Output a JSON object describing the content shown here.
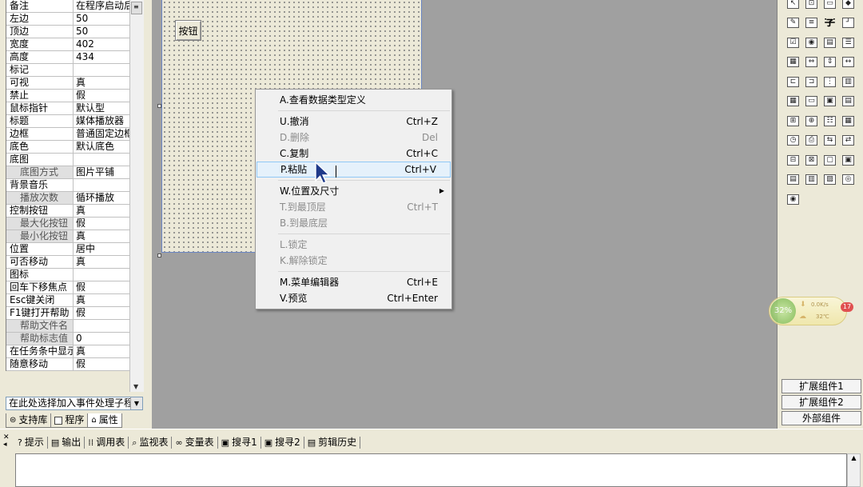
{
  "properties": [
    {
      "name": "备注",
      "value": "在程序启动后",
      "sub": false
    },
    {
      "name": "左边",
      "value": "50",
      "sub": false
    },
    {
      "name": "顶边",
      "value": "50",
      "sub": false
    },
    {
      "name": "宽度",
      "value": "402",
      "sub": false
    },
    {
      "name": "高度",
      "value": "434",
      "sub": false
    },
    {
      "name": "标记",
      "value": "",
      "sub": false
    },
    {
      "name": "可视",
      "value": "真",
      "sub": false
    },
    {
      "name": "禁止",
      "value": "假",
      "sub": false
    },
    {
      "name": "鼠标指针",
      "value": "默认型",
      "sub": false
    },
    {
      "name": "标题",
      "value": "媒体播放器",
      "sub": false
    },
    {
      "name": "边框",
      "value": "普通固定边框",
      "sub": false
    },
    {
      "name": "底色",
      "value": "默认底色",
      "sub": false
    },
    {
      "name": "底图",
      "value": "",
      "sub": false
    },
    {
      "name": "底图方式",
      "value": "图片平铺",
      "sub": true
    },
    {
      "name": "背景音乐",
      "value": "",
      "sub": false
    },
    {
      "name": "播放次数",
      "value": "循环播放",
      "sub": true
    },
    {
      "name": "控制按钮",
      "value": "真",
      "sub": false
    },
    {
      "name": "最大化按钮",
      "value": "假",
      "sub": true
    },
    {
      "name": "最小化按钮",
      "value": "真",
      "sub": true
    },
    {
      "name": "位置",
      "value": "居中",
      "sub": false
    },
    {
      "name": "可否移动",
      "value": "真",
      "sub": false
    },
    {
      "name": "图标",
      "value": "",
      "sub": false
    },
    {
      "name": "回车下移焦点",
      "value": "假",
      "sub": false
    },
    {
      "name": "Esc键关闭",
      "value": "真",
      "sub": false
    },
    {
      "name": "F1键打开帮助",
      "value": "假",
      "sub": false
    },
    {
      "name": "帮助文件名",
      "value": "",
      "sub": true
    },
    {
      "name": "帮助标志值",
      "value": "0",
      "sub": true
    },
    {
      "name": "在任务条中显示",
      "value": "真",
      "sub": false
    },
    {
      "name": "随意移动",
      "value": "假",
      "sub": false
    }
  ],
  "event_select": "在此处选择加入事件处理子程序",
  "panel_tabs": [
    "支持库",
    "程序",
    "属性"
  ],
  "form_button_label": "按钮",
  "context_menu": [
    {
      "type": "item",
      "label": "A.查看数据类型定义",
      "shortcut": "",
      "disabled": false,
      "hover": false,
      "submenu": false
    },
    {
      "type": "sep"
    },
    {
      "type": "item",
      "label": "U.撤消",
      "shortcut": "Ctrl+Z",
      "disabled": false,
      "hover": false,
      "submenu": false
    },
    {
      "type": "item",
      "label": "D.删除",
      "shortcut": "Del",
      "disabled": true,
      "hover": false,
      "submenu": false
    },
    {
      "type": "item",
      "label": "C.复制",
      "shortcut": "Ctrl+C",
      "disabled": false,
      "hover": false,
      "submenu": false
    },
    {
      "type": "item",
      "label": "P.粘贴",
      "shortcut": "Ctrl+V",
      "disabled": false,
      "hover": true,
      "submenu": false
    },
    {
      "type": "sep"
    },
    {
      "type": "item",
      "label": "W.位置及尺寸",
      "shortcut": "",
      "disabled": false,
      "hover": false,
      "submenu": true
    },
    {
      "type": "item",
      "label": "T.到最顶层",
      "shortcut": "Ctrl+T",
      "disabled": true,
      "hover": false,
      "submenu": false
    },
    {
      "type": "item",
      "label": "B.到最底层",
      "shortcut": "",
      "disabled": true,
      "hover": false,
      "submenu": false
    },
    {
      "type": "sep"
    },
    {
      "type": "item",
      "label": "L.锁定",
      "shortcut": "",
      "disabled": true,
      "hover": false,
      "submenu": false
    },
    {
      "type": "item",
      "label": "K.解除锁定",
      "shortcut": "",
      "disabled": true,
      "hover": false,
      "submenu": false
    },
    {
      "type": "sep"
    },
    {
      "type": "item",
      "label": "M.菜单编辑器",
      "shortcut": "Ctrl+E",
      "disabled": false,
      "hover": false,
      "submenu": false
    },
    {
      "type": "item",
      "label": "V.预览",
      "shortcut": "Ctrl+Enter",
      "disabled": false,
      "hover": false,
      "submenu": false
    }
  ],
  "toolbox": {
    "tools": [
      {
        "icon": "pointer-icon",
        "glyph": "↖",
        "text": false
      },
      {
        "icon": "picture-icon",
        "glyph": "⊡",
        "text": false
      },
      {
        "icon": "image-box-icon",
        "glyph": "▭",
        "text": false
      },
      {
        "icon": "shape-icon",
        "glyph": "◆",
        "text": false
      },
      {
        "icon": "edit-box-icon",
        "glyph": "✎",
        "text": false
      },
      {
        "icon": "multiline-edit-icon",
        "glyph": "≡",
        "text": false
      },
      {
        "icon": "label-icon",
        "glyph": "字",
        "text": true
      },
      {
        "icon": "line-icon",
        "glyph": "┘",
        "text": false
      },
      {
        "icon": "checkbox-icon",
        "glyph": "☑",
        "text": false
      },
      {
        "icon": "radio-icon",
        "glyph": "◉",
        "text": false
      },
      {
        "icon": "combobox-icon",
        "glyph": "▤",
        "text": false
      },
      {
        "icon": "listbox-icon",
        "glyph": "☰",
        "text": false
      },
      {
        "icon": "list-icon",
        "glyph": "▦",
        "text": false
      },
      {
        "icon": "scroll-icon",
        "glyph": "⇔",
        "text": false
      },
      {
        "icon": "vertical-scroll-icon",
        "glyph": "⇕",
        "text": false
      },
      {
        "icon": "hscroll-icon",
        "glyph": "↔",
        "text": false
      },
      {
        "icon": "tab-icon",
        "glyph": "⊏",
        "text": false
      },
      {
        "icon": "date-icon",
        "glyph": "⊐",
        "text": false
      },
      {
        "icon": "slider-icon",
        "glyph": "⋮",
        "text": false
      },
      {
        "icon": "progress-icon",
        "glyph": "▥",
        "text": false
      },
      {
        "icon": "grid-icon",
        "glyph": "▦",
        "text": false
      },
      {
        "icon": "button-icon",
        "glyph": "▭",
        "text": false
      },
      {
        "icon": "panel-icon",
        "glyph": "▣",
        "text": false
      },
      {
        "icon": "document-icon",
        "glyph": "▤",
        "text": false
      },
      {
        "icon": "tree-icon",
        "glyph": "⊞",
        "text": false
      },
      {
        "icon": "network-icon",
        "glyph": "⊕",
        "text": false
      },
      {
        "icon": "listview-icon",
        "glyph": "☷",
        "text": false
      },
      {
        "icon": "calendar-icon",
        "glyph": "▦",
        "text": false
      },
      {
        "icon": "timer-icon",
        "glyph": "◷",
        "text": false
      },
      {
        "icon": "printer-icon",
        "glyph": "⎙",
        "text": false
      },
      {
        "icon": "transfer-icon",
        "glyph": "⇆",
        "text": false
      },
      {
        "icon": "socket-icon",
        "glyph": "⇄",
        "text": false
      },
      {
        "icon": "client-icon",
        "glyph": "⊟",
        "text": false
      },
      {
        "icon": "server-icon",
        "glyph": "⊠",
        "text": false
      },
      {
        "icon": "window-icon",
        "glyph": "▢",
        "text": false
      },
      {
        "icon": "frame-icon",
        "glyph": "▣",
        "text": false
      },
      {
        "icon": "database-icon",
        "glyph": "▤",
        "text": false
      },
      {
        "icon": "db-grid-icon",
        "glyph": "▥",
        "text": false
      },
      {
        "icon": "chart-icon",
        "glyph": "▨",
        "text": false
      },
      {
        "icon": "odbc-icon",
        "glyph": "◎",
        "text": false
      },
      {
        "icon": "odbc-source-icon",
        "glyph": "◉",
        "text": false
      }
    ],
    "ext_buttons": [
      "扩展组件1",
      "扩展组件2",
      "外部组件"
    ]
  },
  "net_widget": {
    "percent": "32%",
    "speed": "0.0K/s",
    "temp": "32℃",
    "badge": "17"
  },
  "bottom_tabs": [
    {
      "label": "提示",
      "icon": "hint-icon",
      "glyph": "?"
    },
    {
      "label": "输出",
      "icon": "output-icon",
      "glyph": "▤"
    },
    {
      "label": "调用表",
      "icon": "call-table-icon",
      "glyph": "⁞⁞"
    },
    {
      "label": "监视表",
      "icon": "watch-icon",
      "glyph": "⌕"
    },
    {
      "label": "变量表",
      "icon": "variable-icon",
      "glyph": "∞"
    },
    {
      "label": "搜寻1",
      "icon": "search1-icon",
      "glyph": "▣"
    },
    {
      "label": "搜寻2",
      "icon": "search2-icon",
      "glyph": "▣"
    },
    {
      "label": "剪辑历史",
      "icon": "clip-history-icon",
      "glyph": "▤"
    }
  ],
  "colors": {
    "form_border": "#6b86c4",
    "menu_hover": "#e5f1fb",
    "disabled_text": "#8c8c8c"
  }
}
